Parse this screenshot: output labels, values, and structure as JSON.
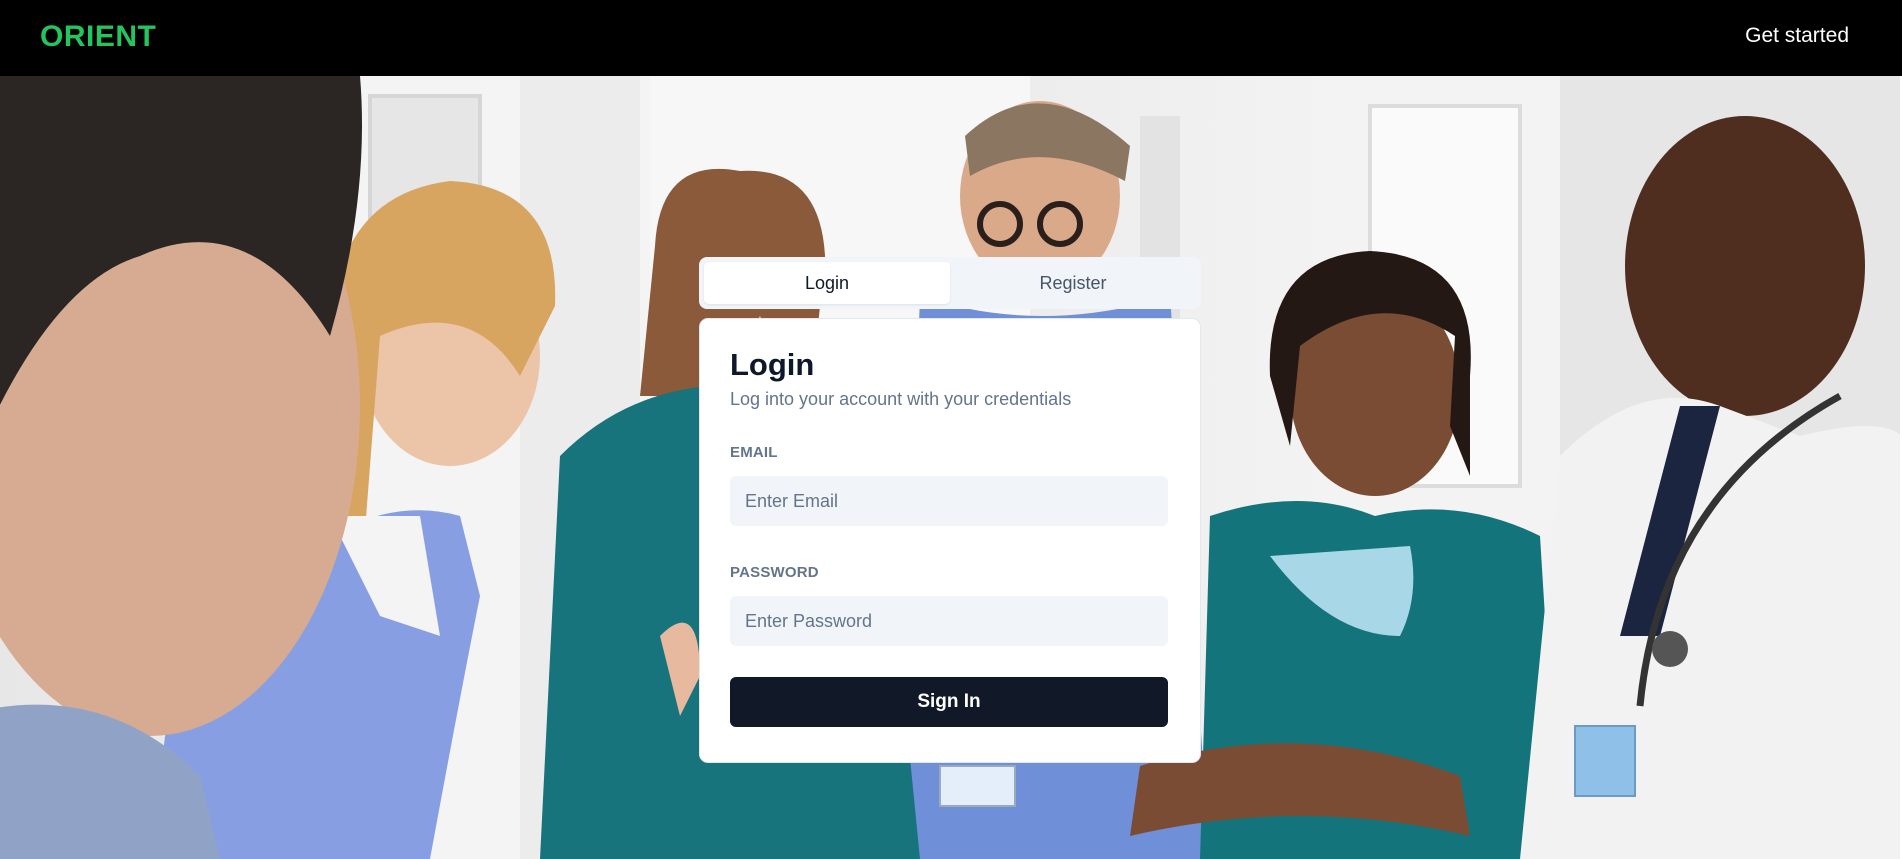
{
  "header": {
    "brand": "ORIENT",
    "get_started": "Get started"
  },
  "tabs": [
    {
      "label": "Login",
      "active": true
    },
    {
      "label": "Register",
      "active": false
    }
  ],
  "form": {
    "title": "Login",
    "subtitle": "Log into your account with your credentials",
    "email_label": "EMAIL",
    "email_placeholder": "Enter Email",
    "email_value": "",
    "password_label": "PASSWORD",
    "password_placeholder": "Enter Password",
    "password_value": "",
    "submit_label": "Sign In"
  },
  "colors": {
    "brand": "#22c55e",
    "header_bg": "#000000",
    "primary_button": "#111827",
    "input_bg": "#f1f5f9",
    "muted_text": "#64748b"
  }
}
